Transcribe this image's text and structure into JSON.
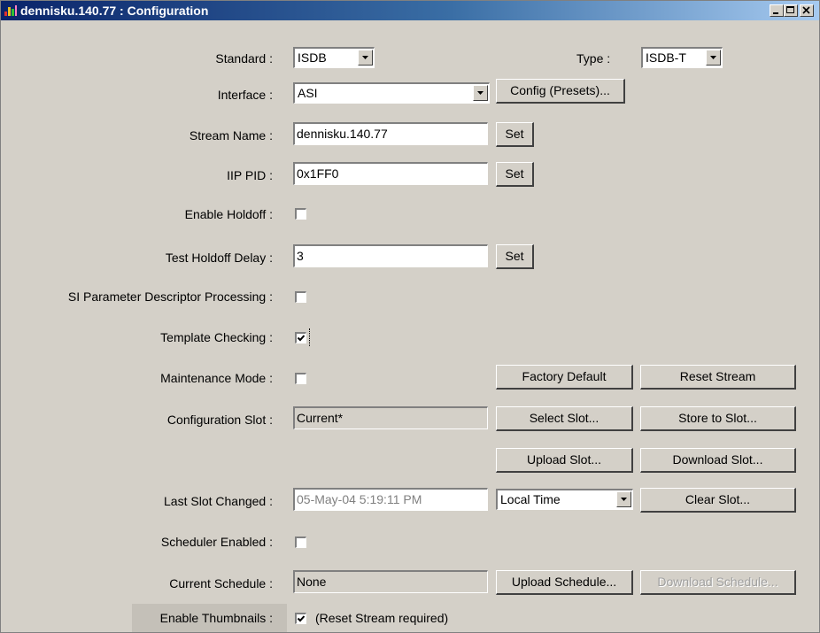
{
  "window": {
    "title": "dennisku.140.77 : Configuration",
    "icon": "app-icon",
    "controls": [
      "minimize-icon",
      "maximize-icon",
      "close-icon"
    ]
  },
  "fields": {
    "standard": {
      "label": "Standard :",
      "value": "ISDB"
    },
    "type": {
      "label": "Type :",
      "value": "ISDB-T"
    },
    "interface": {
      "label": "Interface :",
      "value": "ASI",
      "button": "Config (Presets)..."
    },
    "stream_name": {
      "label": "Stream Name :",
      "value": "dennisku.140.77",
      "button": "Set"
    },
    "iip_pid": {
      "label": "IIP PID :",
      "value": "0x1FF0",
      "button": "Set"
    },
    "enable_holdoff": {
      "label": "Enable Holdoff :",
      "checked": false
    },
    "test_holdoff_delay": {
      "label": "Test Holdoff Delay :",
      "value": "3",
      "button": "Set"
    },
    "si_param": {
      "label": "SI Parameter Descriptor Processing :",
      "checked": false
    },
    "template_checking": {
      "label": "Template Checking :",
      "checked": true
    },
    "maintenance_mode": {
      "label": "Maintenance Mode :",
      "checked": false
    },
    "configuration_slot": {
      "label": "Configuration Slot :",
      "value": "Current*"
    },
    "last_slot_changed": {
      "label": "Last Slot Changed :",
      "value": "05-May-04 5:19:11 PM",
      "time_mode": "Local Time"
    },
    "scheduler_enabled": {
      "label": "Scheduler Enabled :",
      "checked": false
    },
    "current_schedule": {
      "label": "Current Schedule :",
      "value": "None"
    },
    "enable_thumbnails": {
      "label": "Enable Thumbnails :",
      "checked": true,
      "note": "(Reset Stream required)"
    }
  },
  "buttons": {
    "factory_default": "Factory Default",
    "reset_stream": "Reset Stream",
    "select_slot": "Select Slot...",
    "store_to_slot": "Store to Slot...",
    "upload_slot": "Upload Slot...",
    "download_slot": "Download Slot...",
    "clear_slot": "Clear Slot...",
    "upload_schedule": "Upload Schedule...",
    "download_schedule": "Download Schedule..."
  },
  "colors": {
    "face": "#d4d0c8",
    "title_start": "#0a246a",
    "title_end": "#a6caf0"
  }
}
